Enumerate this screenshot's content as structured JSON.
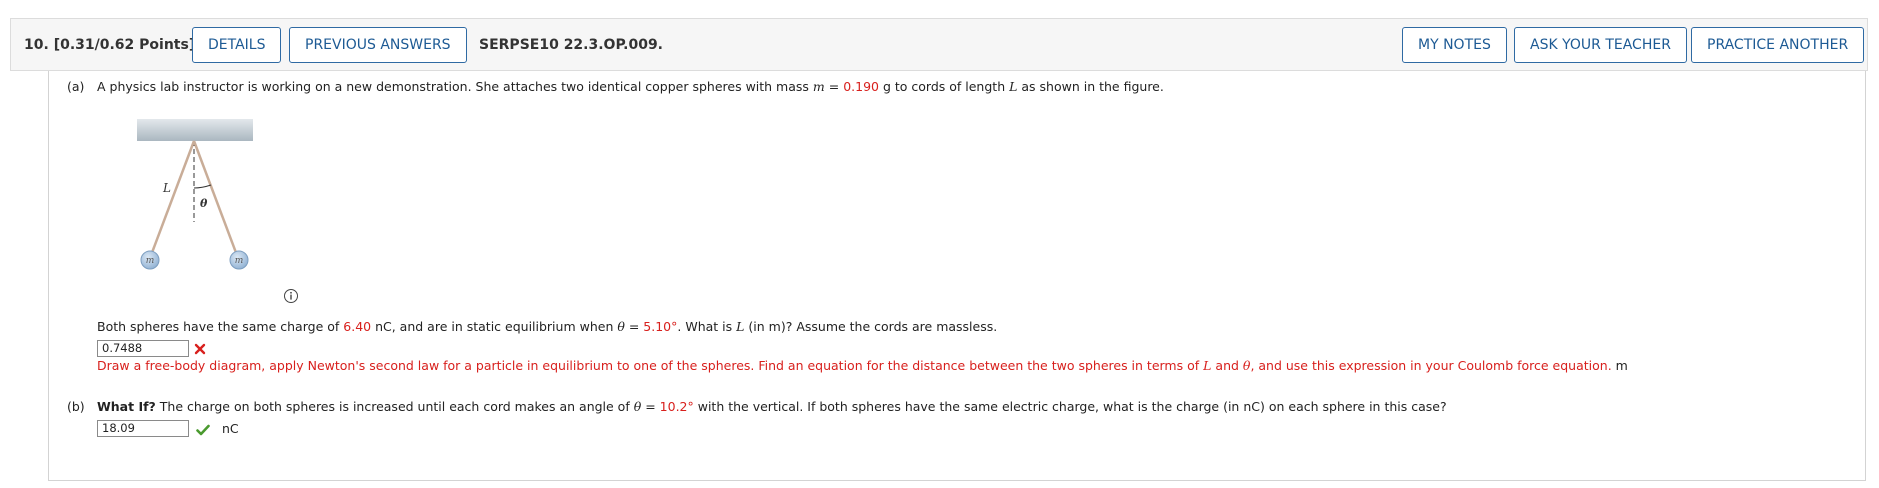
{
  "header": {
    "question_number": "10.",
    "points": "[0.31/0.62 Points]",
    "details_label": "DETAILS",
    "previous_answers_label": "PREVIOUS ANSWERS",
    "question_id": "SERPSE10 22.3.OP.009.",
    "my_notes_label": "MY NOTES",
    "ask_teacher_label": "ASK YOUR TEACHER",
    "practice_another_label": "PRACTICE ANOTHER"
  },
  "part_a": {
    "marker": "(a)",
    "intro_1": "A physics lab instructor is working on a new demonstration. She attaches two identical copper spheres with mass ",
    "mass_var": "m",
    "eq": " = ",
    "mass_value": "0.190",
    "intro_2": " g to cords of length ",
    "length_var": "L",
    "intro_3": " as shown in the figure.",
    "figure": {
      "length_label": "L",
      "angle_label": "θ",
      "mass_label_left": "m",
      "mass_label_right": "m"
    },
    "q_1": "Both spheres have the same charge of ",
    "charge_value": "6.40",
    "q_2": " nC, and are in static equilibrium when ",
    "theta": "θ",
    "q_eq": " = ",
    "angle_value": "5.10°",
    "q_3": ". What is ",
    "q_L": "L",
    "q_4": " (in m)? Assume the cords are massless.",
    "answer": "0.7488",
    "status": "incorrect",
    "feedback_1": "Draw a free-body diagram, apply Newton's second law for a particle in equilibrium to one of the spheres. Find an equation for the distance between the two spheres in terms of ",
    "feedback_L": "L",
    "feedback_2": " and ",
    "feedback_theta": "θ",
    "feedback_3": ", and use this expression in your Coulomb force equation.",
    "unit": "m"
  },
  "part_b": {
    "marker": "(b)",
    "what_if": "What If?",
    "q_1": " The charge on both spheres is increased until each cord makes an angle of ",
    "theta": "θ",
    "eq": " = ",
    "angle_value": "10.2°",
    "q_2": " with the vertical. If both spheres have the same electric charge, what is the charge (in nC) on each sphere in this case?",
    "answer": "18.09",
    "status": "correct",
    "unit": "nC"
  },
  "colors": {
    "accent": "#1d5a94",
    "incorrect": "#d8201d",
    "correct": "#4a9a2f",
    "sphere": "#a9c4e0"
  }
}
